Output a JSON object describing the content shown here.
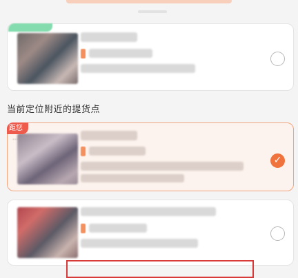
{
  "header": {
    "section_title": "当前定位附近的提货点"
  },
  "badges": {
    "distance_badge": "距您",
    "distance_badge_sub": "..."
  },
  "radio_icons": {
    "checked_mark": "✓"
  },
  "colors": {
    "accent": "#f0733e",
    "selected_border": "#f2a47f",
    "selected_bg": "#fdf3ee",
    "badge_red": "#ee5a4c",
    "badge_green": "#6fd7a0",
    "highlight_box": "#d83a3a"
  },
  "pickup_points": [
    {
      "selected": false,
      "has_badge": "green"
    },
    {
      "selected": true,
      "has_badge": "red"
    },
    {
      "selected": false,
      "has_badge": "none"
    }
  ]
}
